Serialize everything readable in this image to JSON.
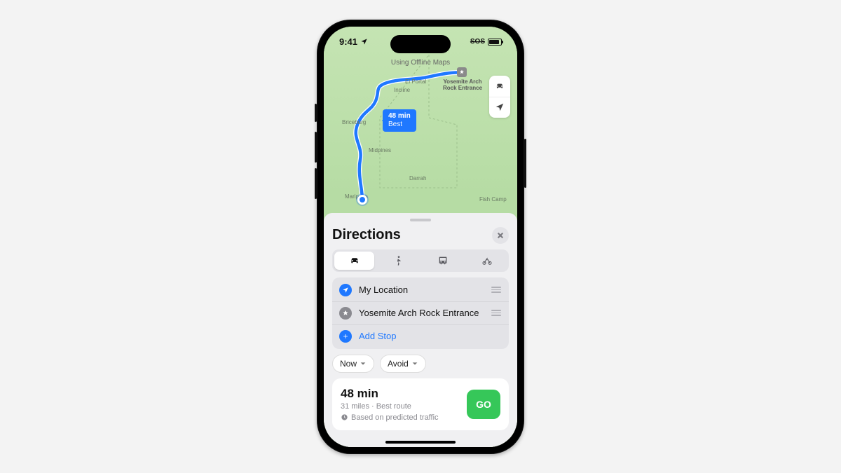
{
  "status": {
    "time": "9:41",
    "sos": "SOS"
  },
  "map": {
    "banner": "Using Offline Maps",
    "labels": {
      "elportal": "El Portal",
      "incline": "Incline",
      "briceburg": "Briceburg",
      "midpines": "Midpines",
      "darrah": "Darrah",
      "mariposa": "Mariposa",
      "fishcamp": "Fish Camp"
    },
    "badge": {
      "line1": "48 min",
      "line2": "Best"
    },
    "dest_label_l1": "Yosemite Arch",
    "dest_label_l2": "Rock Entrance"
  },
  "sheet": {
    "title": "Directions",
    "stops": {
      "origin": "My Location",
      "dest": "Yosemite Arch Rock Entrance",
      "add": "Add Stop"
    },
    "chips": {
      "now": "Now",
      "avoid": "Avoid"
    },
    "route": {
      "time": "48 min",
      "sub": "31 miles · Best route",
      "note": "Based on predicted traffic",
      "go": "GO"
    }
  }
}
